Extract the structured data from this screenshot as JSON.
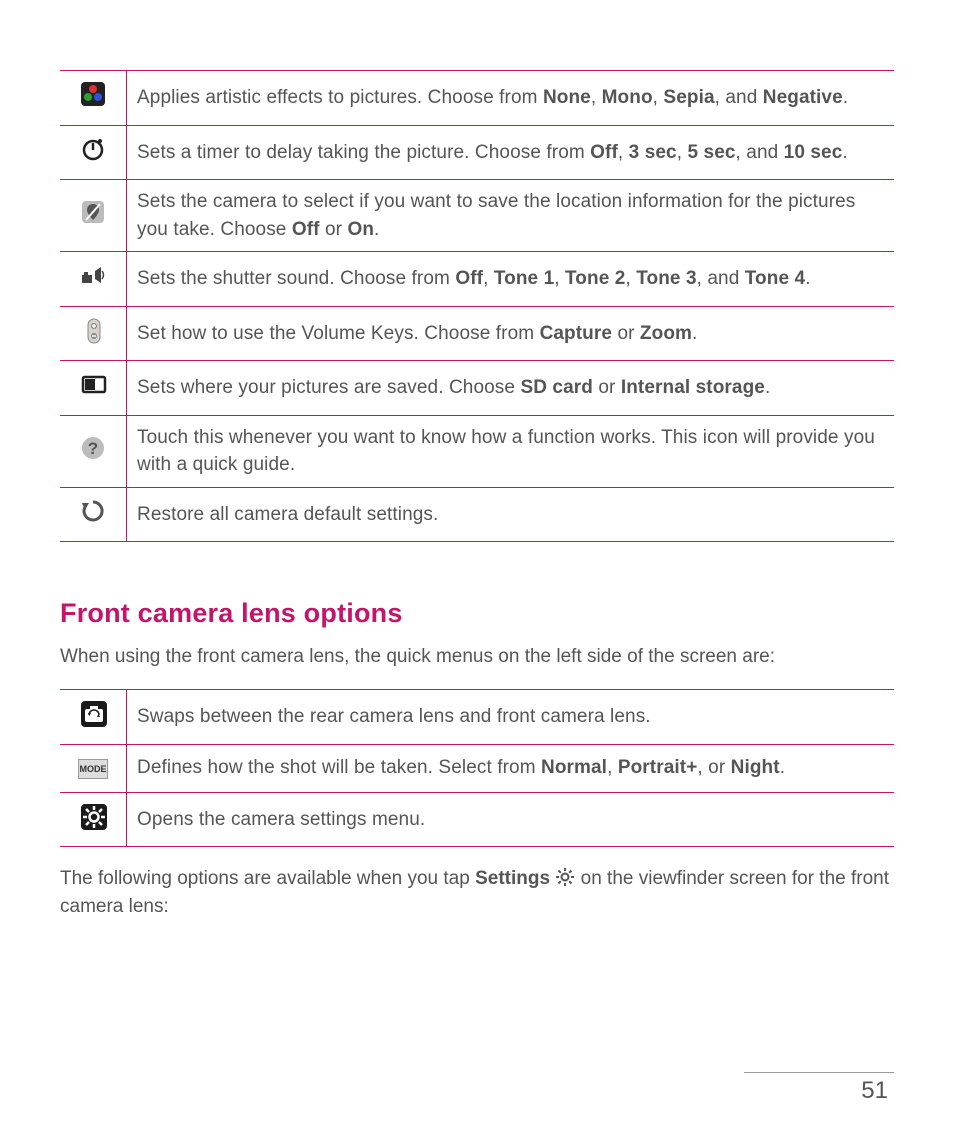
{
  "table1": {
    "rows": [
      {
        "icon": "color-effect-icon",
        "segments": [
          {
            "t": "Applies artistic effects to pictures. Choose from "
          },
          {
            "t": "None",
            "b": true
          },
          {
            "t": ", "
          },
          {
            "t": "Mono",
            "b": true
          },
          {
            "t": ", "
          },
          {
            "t": "Sepia",
            "b": true
          },
          {
            "t": ", and "
          },
          {
            "t": "Negative",
            "b": true
          },
          {
            "t": "."
          }
        ]
      },
      {
        "icon": "timer-icon",
        "segments": [
          {
            "t": "Sets a timer to delay taking the picture. Choose from "
          },
          {
            "t": "Off",
            "b": true
          },
          {
            "t": ", "
          },
          {
            "t": "3 sec",
            "b": true
          },
          {
            "t": ", "
          },
          {
            "t": "5 sec",
            "b": true
          },
          {
            "t": ", and "
          },
          {
            "t": "10 sec",
            "b": true
          },
          {
            "t": "."
          }
        ]
      },
      {
        "icon": "geotag-icon",
        "segments": [
          {
            "t": "Sets the camera to select if you want to save the location information for the pictures you take. Choose "
          },
          {
            "t": "Off",
            "b": true
          },
          {
            "t": " or "
          },
          {
            "t": "On",
            "b": true
          },
          {
            "t": "."
          }
        ]
      },
      {
        "icon": "shutter-sound-icon",
        "segments": [
          {
            "t": "Sets the shutter sound. Choose from "
          },
          {
            "t": "Off",
            "b": true
          },
          {
            "t": ", "
          },
          {
            "t": "Tone 1",
            "b": true
          },
          {
            "t": ", "
          },
          {
            "t": "Tone 2",
            "b": true
          },
          {
            "t": ", "
          },
          {
            "t": "Tone 3",
            "b": true
          },
          {
            "t": ", and "
          },
          {
            "t": "Tone 4",
            "b": true
          },
          {
            "t": "."
          }
        ]
      },
      {
        "icon": "volume-key-icon",
        "segments": [
          {
            "t": "Set how to use the Volume Keys. Choose from "
          },
          {
            "t": "Capture",
            "b": true
          },
          {
            "t": " or "
          },
          {
            "t": "Zoom",
            "b": true
          },
          {
            "t": "."
          }
        ]
      },
      {
        "icon": "storage-icon",
        "segments": [
          {
            "t": "Sets where your pictures are saved. Choose "
          },
          {
            "t": "SD card",
            "b": true
          },
          {
            "t": " or "
          },
          {
            "t": "Internal storage",
            "b": true
          },
          {
            "t": "."
          }
        ]
      },
      {
        "icon": "help-icon",
        "segments": [
          {
            "t": "Touch this whenever you want to know how a function works. This icon will provide you with a quick guide."
          }
        ]
      },
      {
        "icon": "reset-icon",
        "segments": [
          {
            "t": "Restore all camera default settings."
          }
        ]
      }
    ]
  },
  "section_heading": "Front camera lens options",
  "section_intro": "When using the front camera lens, the quick menus on the left side of the screen are:",
  "table2": {
    "rows": [
      {
        "icon": "swap-camera-icon",
        "segments": [
          {
            "t": "Swaps between the rear camera lens and front camera lens."
          }
        ]
      },
      {
        "icon": "mode-icon",
        "segments": [
          {
            "t": "Defines how the shot will be taken. Select from "
          },
          {
            "t": "Normal",
            "b": true
          },
          {
            "t": ", "
          },
          {
            "t": "Portrait+",
            "b": true
          },
          {
            "t": ", or "
          },
          {
            "t": "Night",
            "b": true
          },
          {
            "t": "."
          }
        ]
      },
      {
        "icon": "settings-icon",
        "segments": [
          {
            "t": "Opens the camera settings menu."
          }
        ]
      }
    ]
  },
  "closing_segments": [
    {
      "t": "The following options are available when you tap "
    },
    {
      "t": "Settings",
      "b": true
    },
    {
      "t": " "
    },
    {
      "icon": "settings-icon-inline"
    },
    {
      "t": " on the viewfinder screen for the front camera lens:"
    }
  ],
  "mode_label": "MODE",
  "page_number": "51"
}
